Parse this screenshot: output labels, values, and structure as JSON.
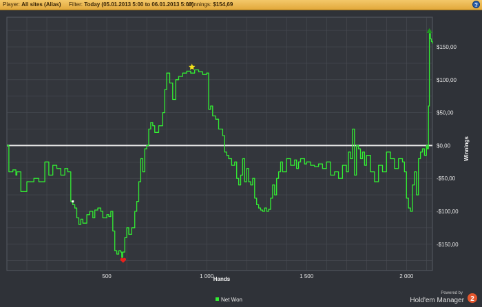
{
  "header": {
    "player_label": "Player:",
    "player_value": "All sites (Alias)",
    "filter_label": "Filter:",
    "filter_value": "Today (05.01.2013 5:00 to 06.01.2013 5:00)",
    "winnings_label": "Winnings:",
    "winnings_value": "$154,69",
    "help_icon": "?"
  },
  "footer": {
    "legend_label": "Net Won",
    "powered_by": "Powered by",
    "brand": "Hold'em Manager",
    "brand_badge": "2"
  },
  "colors": {
    "background": "#2f3238",
    "plot_background": "#33363c",
    "grid": "#4a4d54",
    "line": "#33ee33",
    "zero_line": "#e8e8e8",
    "header": "#e8b44a",
    "max_marker": "#f2e21a",
    "min_marker": "#e8211c",
    "end_marker": "#1f9a1f"
  },
  "markers": {
    "max_star": "star-icon",
    "min_heart": "heart-icon",
    "end_triangle": "triangle-up-icon"
  },
  "chart_data": {
    "type": "line",
    "xlabel": "Hands",
    "ylabel": "Winnings",
    "xlim": [
      0,
      2130
    ],
    "ylim": [
      -190,
      195
    ],
    "x_ticks": [
      {
        "value": 500,
        "label": "500"
      },
      {
        "value": 1000,
        "label": "1 000"
      },
      {
        "value": 1500,
        "label": "1 500"
      },
      {
        "value": 2000,
        "label": "2 000"
      }
    ],
    "y_ticks": [
      {
        "value": 150,
        "label": "$150,00"
      },
      {
        "value": 100,
        "label": "$100,00"
      },
      {
        "value": 50,
        "label": "$50,00"
      },
      {
        "value": 0,
        "label": "$0,00"
      },
      {
        "value": -50,
        "label": "-$50,00"
      },
      {
        "value": -100,
        "label": "-$100,00"
      },
      {
        "value": -150,
        "label": "-$150,00"
      }
    ],
    "grid": true,
    "legend_position": "bottom-center",
    "series": [
      {
        "name": "Net Won",
        "x": [
          0,
          10,
          30,
          45,
          50,
          70,
          100,
          135,
          160,
          190,
          210,
          230,
          250,
          270,
          290,
          305,
          320,
          330,
          340,
          350,
          360,
          370,
          380,
          400,
          415,
          430,
          440,
          455,
          470,
          480,
          500,
          510,
          520,
          530,
          540,
          550,
          560,
          570,
          575,
          580,
          590,
          600,
          610,
          625,
          640,
          650,
          660,
          670,
          680,
          690,
          700,
          710,
          720,
          730,
          740,
          760,
          780,
          790,
          800,
          815,
          830,
          845,
          860,
          880,
          900,
          920,
          940,
          960,
          980,
          1000,
          1010,
          1020,
          1030,
          1045,
          1060,
          1080,
          1090,
          1100,
          1110,
          1125,
          1140,
          1150,
          1160,
          1170,
          1180,
          1190,
          1200,
          1210,
          1220,
          1230,
          1240,
          1250,
          1260,
          1270,
          1280,
          1290,
          1300,
          1310,
          1320,
          1330,
          1340,
          1350,
          1360,
          1370,
          1380,
          1400,
          1420,
          1440,
          1450,
          1460,
          1470,
          1490,
          1500,
          1520,
          1540,
          1560,
          1580,
          1600,
          1620,
          1640,
          1660,
          1680,
          1700,
          1710,
          1720,
          1730,
          1740,
          1750,
          1760,
          1770,
          1780,
          1790,
          1800,
          1820,
          1840,
          1860,
          1880,
          1900,
          1920,
          1940,
          1960,
          1980,
          1990,
          2000,
          2010,
          2020,
          2030,
          2040,
          2050,
          2060,
          2070,
          2080,
          2090,
          2100,
          2105,
          2110,
          2115,
          2120,
          2125,
          2130
        ],
        "y": [
          0,
          -40,
          -37,
          -45,
          -40,
          -70,
          -55,
          -50,
          -55,
          -25,
          -45,
          -30,
          -35,
          -45,
          -35,
          -40,
          -85,
          -90,
          -95,
          -110,
          -120,
          -112,
          -118,
          -105,
          -100,
          -110,
          -98,
          -95,
          -100,
          -110,
          -105,
          -108,
          -100,
          -130,
          -160,
          -165,
          -160,
          -162,
          -170,
          -162,
          -140,
          -125,
          -135,
          -125,
          -100,
          -85,
          -55,
          -20,
          -40,
          -5,
          0,
          25,
          35,
          30,
          20,
          30,
          50,
          85,
          110,
          95,
          70,
          100,
          105,
          110,
          113,
          110,
          115,
          112,
          108,
          110,
          55,
          60,
          45,
          40,
          25,
          15,
          -10,
          -15,
          -20,
          -30,
          -25,
          -50,
          -60,
          -45,
          -20,
          -55,
          -35,
          -55,
          -60,
          -50,
          -80,
          -90,
          -95,
          -98,
          -100,
          -95,
          -100,
          -97,
          -80,
          -60,
          -75,
          -50,
          -40,
          -25,
          -40,
          -20,
          -30,
          -22,
          -35,
          -25,
          -20,
          -28,
          -25,
          -30,
          -32,
          -28,
          -35,
          -25,
          -45,
          -40,
          -50,
          -30,
          -40,
          -10,
          -20,
          25,
          -45,
          0,
          -5,
          -20,
          -10,
          -30,
          -15,
          -40,
          -55,
          -30,
          -40,
          -10,
          -20,
          -35,
          -20,
          -25,
          -40,
          -80,
          -95,
          -100,
          -60,
          -40,
          -75,
          -20,
          -10,
          -5,
          -15,
          0,
          -5,
          60,
          170,
          162,
          158,
          155
        ]
      }
    ]
  }
}
